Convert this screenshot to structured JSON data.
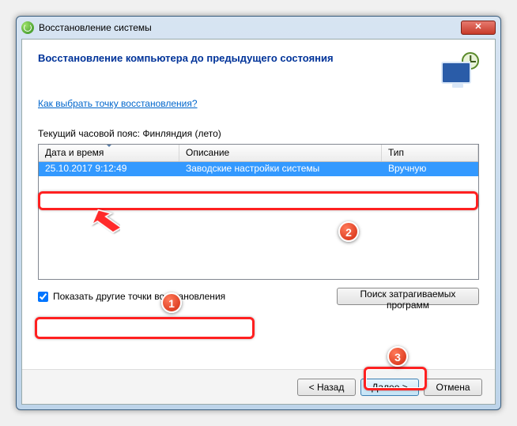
{
  "window": {
    "title": "Восстановление системы"
  },
  "heading": "Восстановление компьютера до предыдущего состояния",
  "help_link": "Как выбрать точку восстановления?",
  "timezone_label": "Текущий часовой пояс: Финляндия (лето)",
  "table": {
    "columns": {
      "datetime": "Дата и время",
      "description": "Описание",
      "type": "Тип"
    },
    "rows": [
      {
        "datetime": "25.10.2017 9:12:49",
        "description": "Заводские настройки системы",
        "type": "Вручную"
      }
    ]
  },
  "show_other_points": {
    "label": "Показать другие точки восстановления",
    "checked": true
  },
  "scan_button": "Поиск затрагиваемых программ",
  "footer": {
    "back": "< Назад",
    "next": "Далее >",
    "cancel": "Отмена"
  },
  "annotations": {
    "b1": "1",
    "b2": "2",
    "b3": "3"
  }
}
